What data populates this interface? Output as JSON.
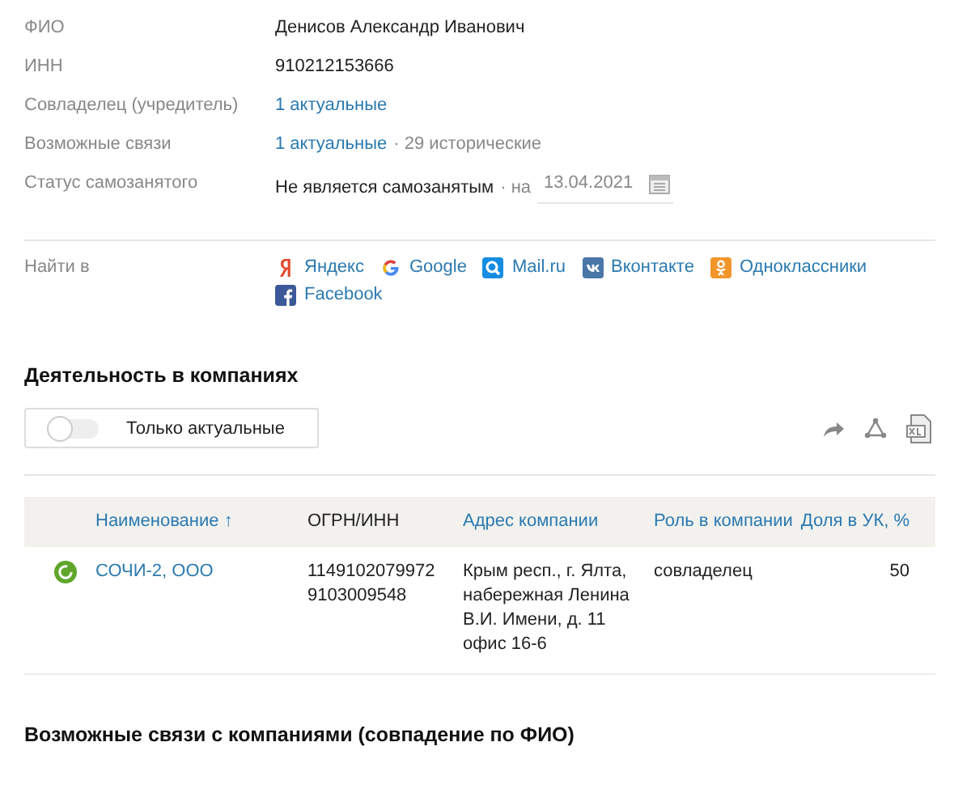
{
  "fields": [
    {
      "label": "ФИО",
      "kind": "text",
      "value": "Денисов Александр Иванович"
    },
    {
      "label": "ИНН",
      "kind": "text",
      "value": "910212153666"
    },
    {
      "label": "Совладелец (учредитель)",
      "kind": "link",
      "link": "1 актуальные"
    },
    {
      "label": "Возможные связи",
      "kind": "link_extra",
      "link": "1 актуальные",
      "extra": "· 29 исторические"
    },
    {
      "label": "Статус самозанятого",
      "kind": "status",
      "value": "Не является самозанятым",
      "prefix": "· на",
      "date": "13.04.2021"
    }
  ],
  "search": {
    "label": "Найти в",
    "sites": [
      {
        "name": "Яндекс",
        "kind": "yandex"
      },
      {
        "name": "Google",
        "kind": "google"
      },
      {
        "name": "Mail.ru",
        "kind": "mail"
      },
      {
        "name": "Вконтакте",
        "kind": "vk"
      },
      {
        "name": "Одноклассники",
        "kind": "ok"
      },
      {
        "name": "Facebook",
        "kind": "facebook"
      }
    ]
  },
  "activity": {
    "title": "Деятельность в компаниях",
    "filter": {
      "label": "Только актуальные",
      "on": false
    },
    "table": {
      "columns": [
        {
          "label": "Наименование",
          "link": true,
          "sort_mark": "↑"
        },
        {
          "label": "ОГРН/ИНН",
          "link": false
        },
        {
          "label": "Адрес компании",
          "link": true
        },
        {
          "label": "Роль в компании",
          "link": true
        },
        {
          "label": "Доля в УК, %",
          "link": true
        }
      ],
      "rows": [
        {
          "active": true,
          "name": "СОЧИ-2, ООО",
          "ogrn": "1149102079972",
          "inn": "9103009548",
          "address": "Крым респ., г. Ялта, набережная Ленина В.И. Имени, д. 11 офис 16-6",
          "role": "совладелец",
          "share": "50"
        }
      ]
    }
  },
  "related": {
    "title": "Возможные связи с компаниями (совпадение по ФИО)"
  }
}
